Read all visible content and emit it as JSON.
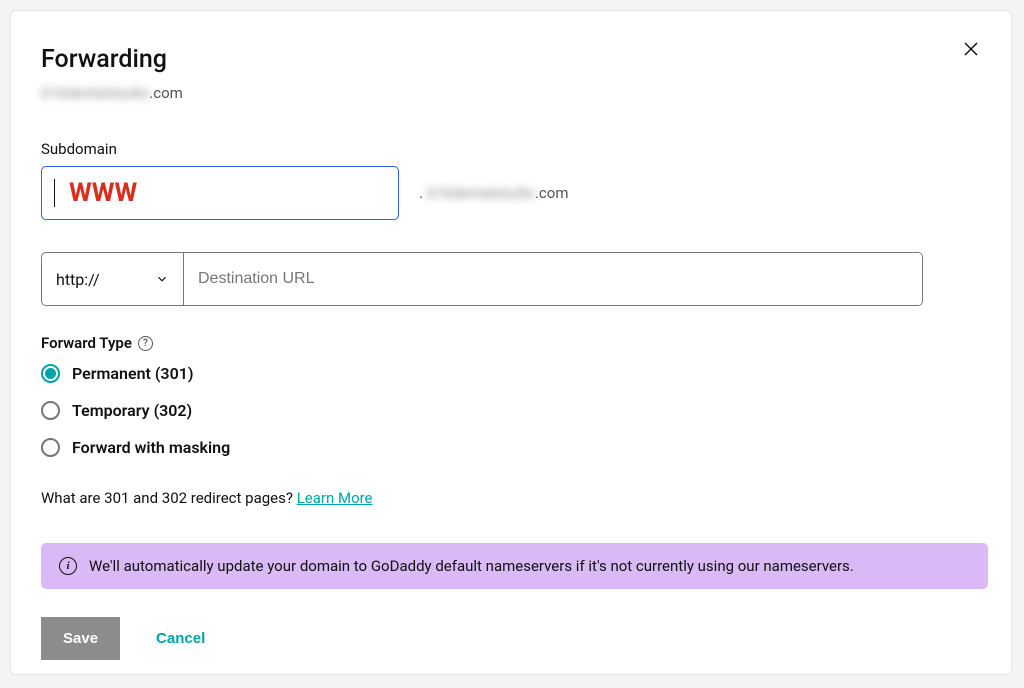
{
  "title": "Forwarding",
  "domain_blurred": "616dentalstudio",
  "domain_suffix": ".com",
  "subdomain": {
    "label": "Subdomain",
    "value": "WWW",
    "suffix_blurred": "616dentalstudio",
    "suffix": ".com"
  },
  "url": {
    "protocol": "http://",
    "placeholder": "Destination URL",
    "value": ""
  },
  "forward_type": {
    "label": "Forward Type",
    "options": [
      {
        "label": "Permanent (301)",
        "selected": true
      },
      {
        "label": "Temporary (302)",
        "selected": false
      },
      {
        "label": "Forward with masking",
        "selected": false
      }
    ]
  },
  "learn": {
    "text": "What are 301 and 302 redirect pages? ",
    "link_label": "Learn More"
  },
  "notice": "We'll automatically update your domain to GoDaddy default nameservers if it's not currently using our nameservers.",
  "buttons": {
    "save": "Save",
    "cancel": "Cancel"
  }
}
